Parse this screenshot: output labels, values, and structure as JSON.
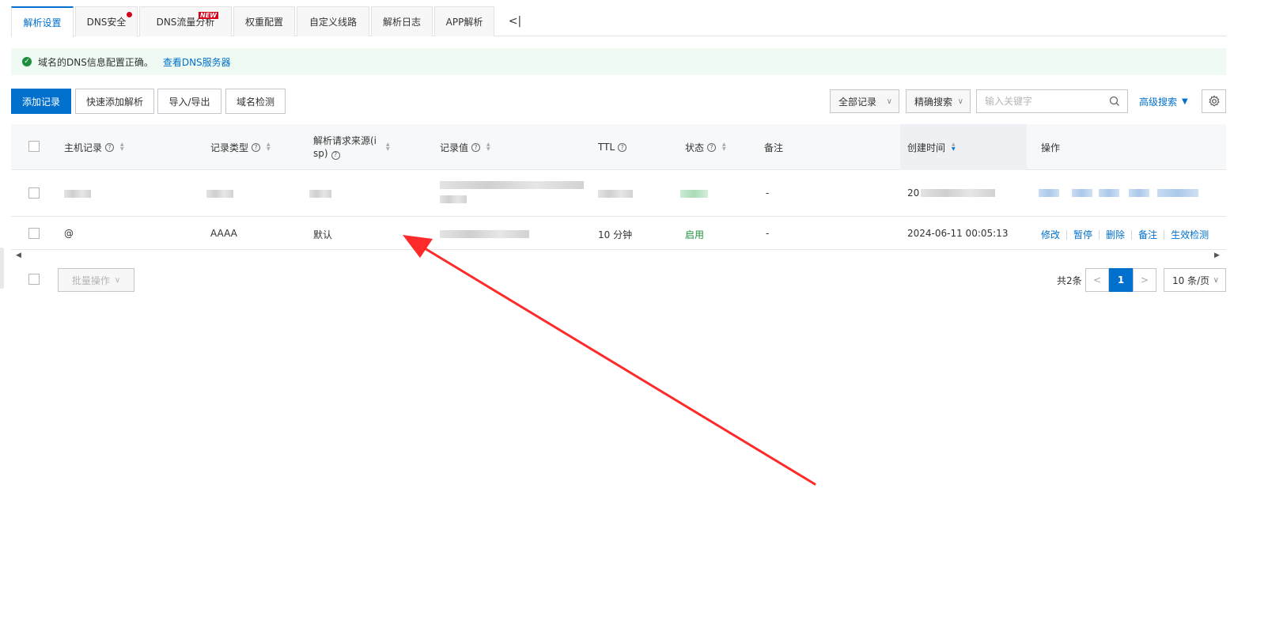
{
  "tabs": [
    {
      "label": "解析设置",
      "active": true
    },
    {
      "label": "DNS安全",
      "dot": true
    },
    {
      "label": "DNS流量分析",
      "badge": "NEW"
    },
    {
      "label": "权重配置"
    },
    {
      "label": "自定义线路"
    },
    {
      "label": "解析日志"
    },
    {
      "label": "APP解析"
    }
  ],
  "collapse_glyph": "<|",
  "notice": {
    "message": "域名的DNS信息配置正确。",
    "link": "查看DNS服务器"
  },
  "toolbar": {
    "add_record": "添加记录",
    "quick_add": "快速添加解析",
    "import_export": "导入/导出",
    "domain_check": "域名检测",
    "filter_all": "全部记录",
    "filter_exact": "精确搜索",
    "search_placeholder": "输入关键字",
    "advanced_search": "高级搜索"
  },
  "table": {
    "headers": {
      "host": "主机记录",
      "type": "记录类型",
      "isp": "解析请求来源(isp)",
      "value": "记录值",
      "ttl": "TTL",
      "status": "状态",
      "remark": "备注",
      "created": "创建时间",
      "ops": "操作"
    },
    "rows": [
      {
        "remark": "-",
        "created_prefix": "20"
      },
      {
        "host": "@",
        "type": "AAAA",
        "isp": "默认",
        "ttl": "10 分钟",
        "status": "启用",
        "remark": "-",
        "created": "2024-06-11 00:05:13",
        "actions": [
          "修改",
          "暂停",
          "删除",
          "备注",
          "生效检测"
        ]
      }
    ]
  },
  "footer": {
    "batch": "批量操作",
    "total": "共2条",
    "current_page": "1",
    "page_size": "10 条/页"
  },
  "colors": {
    "primary": "#0070cc",
    "success": "#1e8e3e",
    "badge": "#d9001b",
    "annotation": "#ff2a2a"
  },
  "icons": [
    "check-circle-icon",
    "search-icon",
    "gear-icon",
    "chevron-down-icon",
    "question-icon",
    "sort-icon",
    "caret-down-icon"
  ]
}
